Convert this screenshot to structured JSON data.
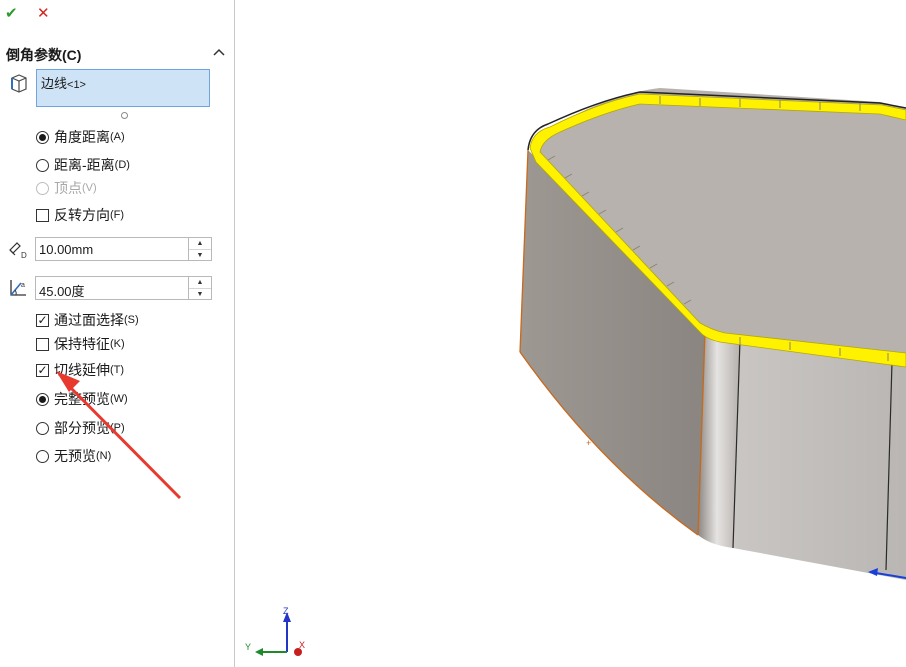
{
  "toolbar": {
    "ok_symbol": "✔",
    "cancel_symbol": "✕"
  },
  "section": {
    "title": "倒角参数(C)"
  },
  "selection": {
    "text": "边线",
    "count": "<1>"
  },
  "chamfer_type": [
    {
      "label": "角度距离",
      "key": "(A)",
      "selected": true,
      "enabled": true
    },
    {
      "label": "距离-距离",
      "key": "(D)",
      "selected": false,
      "enabled": true
    },
    {
      "label": "顶点",
      "key": "(V)",
      "selected": false,
      "enabled": false
    }
  ],
  "flip_direction": {
    "label": "反转方向",
    "key": "(F)",
    "checked": false
  },
  "distance": {
    "value": "10.00mm"
  },
  "angle": {
    "value": "45.00度"
  },
  "options": [
    {
      "label": "通过面选择",
      "key": "(S)",
      "checked": true
    },
    {
      "label": "保持特征",
      "key": "(K)",
      "checked": false
    },
    {
      "label": "切线延伸",
      "key": "(T)",
      "checked": true
    }
  ],
  "preview": [
    {
      "label": "完整预览",
      "key": "(W)",
      "selected": true
    },
    {
      "label": "部分预览",
      "key": "(P)",
      "selected": false
    },
    {
      "label": "无预览",
      "key": "(N)",
      "selected": false
    }
  ],
  "triad": {
    "x": "X",
    "y": "Y",
    "z": "Z"
  },
  "colors": {
    "edge_highlight": "#ffff00",
    "arrow": "#e8392f",
    "model_gray": "#b7b2ad"
  }
}
